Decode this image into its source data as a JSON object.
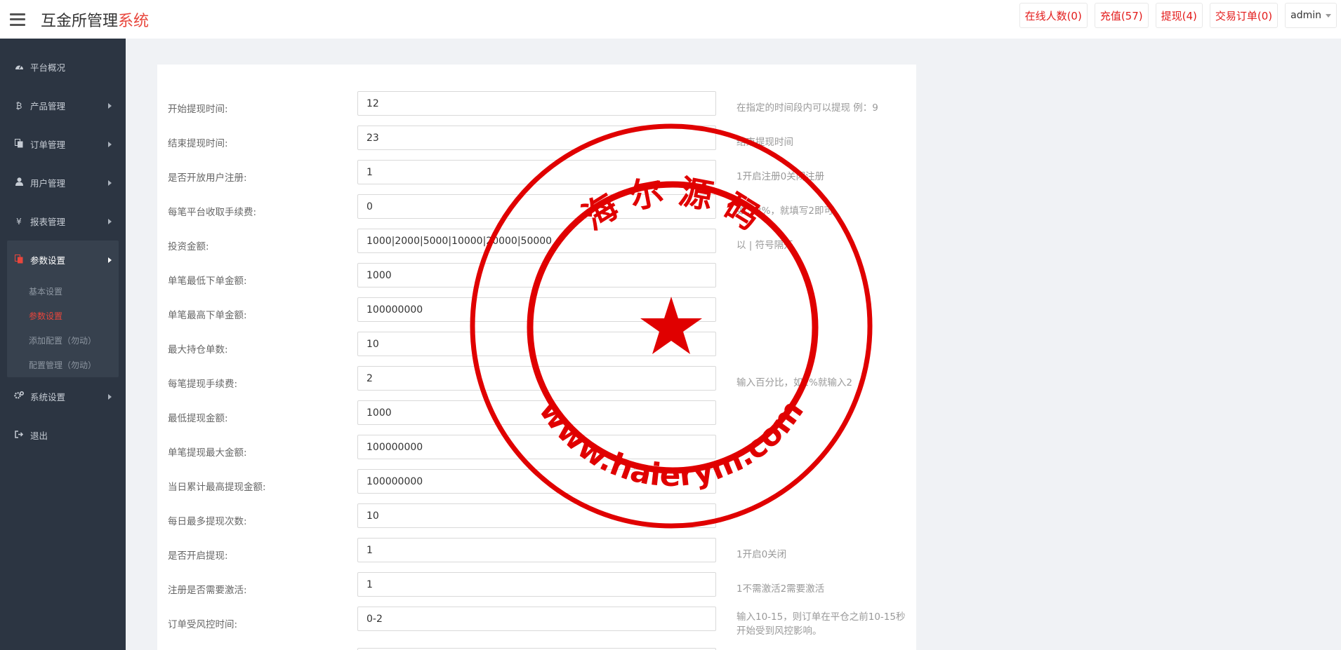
{
  "header": {
    "brand_main": "互金所管理",
    "brand_accent": "系统",
    "buttons": [
      {
        "label": "在线人数(0)"
      },
      {
        "label": "充值(57)"
      },
      {
        "label": "提现(4)"
      },
      {
        "label": "交易订单(0)"
      }
    ],
    "user": "admin"
  },
  "sidebar": {
    "items": [
      {
        "label": "平台概况",
        "icon": "dashboard-icon"
      },
      {
        "label": "产品管理",
        "icon": "bitcoin-icon"
      },
      {
        "label": "订单管理",
        "icon": "copy-icon"
      },
      {
        "label": "用户管理",
        "icon": "user-icon"
      },
      {
        "label": "报表管理",
        "icon": "yen-icon"
      },
      {
        "label": "参数设置",
        "icon": "copy-icon"
      },
      {
        "label": "系统设置",
        "icon": "gears-icon"
      },
      {
        "label": "退出",
        "icon": "sign-out-icon"
      }
    ],
    "sub_items": [
      {
        "label": "基本设置"
      },
      {
        "label": "参数设置"
      },
      {
        "label": "添加配置（勿动）"
      },
      {
        "label": "配置管理（勿动）"
      }
    ]
  },
  "form": {
    "rows": [
      {
        "label": "开始提现时间:",
        "value": "12",
        "hint": "在指定的时间段内可以提现 例：9"
      },
      {
        "label": "结束提现时间:",
        "value": "23",
        "hint": "结束提现时间"
      },
      {
        "label": "是否开放用户注册:",
        "value": "1",
        "hint": "1开启注册0关闭注册"
      },
      {
        "label": "每笔平台收取手续费:",
        "value": "0",
        "hint": "如：2%，就填写2即可"
      },
      {
        "label": "投资金额:",
        "value": "1000|2000|5000|10000|20000|50000",
        "hint": "以 | 符号隔开"
      },
      {
        "label": "单笔最低下单金额:",
        "value": "1000",
        "hint": ""
      },
      {
        "label": "单笔最高下单金额:",
        "value": "100000000",
        "hint": ""
      },
      {
        "label": "最大持仓单数:",
        "value": "10",
        "hint": ""
      },
      {
        "label": "每笔提现手续费:",
        "value": "2",
        "hint": "输入百分比，如2%就输入2"
      },
      {
        "label": "最低提现金额:",
        "value": "1000",
        "hint": ""
      },
      {
        "label": "单笔提现最大金额:",
        "value": "100000000",
        "hint": ""
      },
      {
        "label": "当日累计最高提现金额:",
        "value": "100000000",
        "hint": ""
      },
      {
        "label": "每日最多提现次数:",
        "value": "10",
        "hint": ""
      },
      {
        "label": "是否开启提现:",
        "value": "1",
        "hint": "1开启0关闭"
      },
      {
        "label": "注册是否需要激活:",
        "value": "1",
        "hint": "1不需激活2需要激活"
      },
      {
        "label": "订单受风控时间:",
        "value": "0-2",
        "hint": "输入10-15，则订单在平仓之前10-15秒开始受到风控影响。"
      }
    ]
  },
  "watermark": {
    "top_text": "海 尔 源 码",
    "bottom_text": "www.haierym.com",
    "color": "#e00000"
  }
}
